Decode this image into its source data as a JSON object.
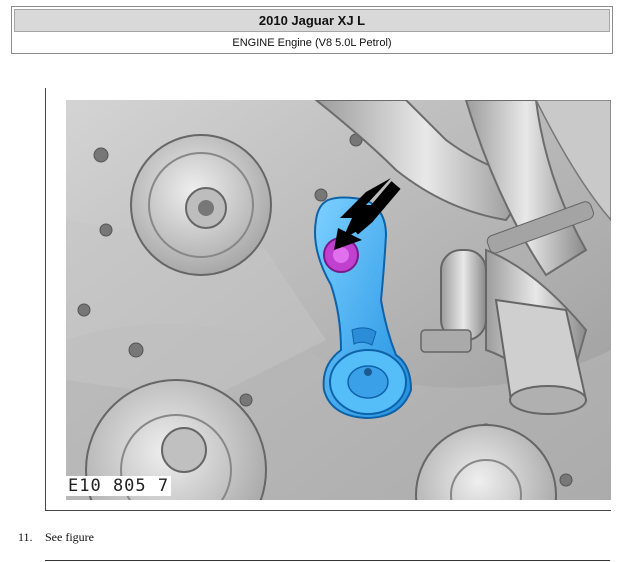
{
  "header": {
    "title": "2010 Jaguar XJ L",
    "subtitle": "ENGINE Engine (V8 5.0L Petrol)"
  },
  "figure": {
    "code": "E10 805 7",
    "highlight_color": "#3aa8f0",
    "bolt_color": "#c040d0"
  },
  "step": {
    "number": "11.",
    "text": "See figure"
  }
}
